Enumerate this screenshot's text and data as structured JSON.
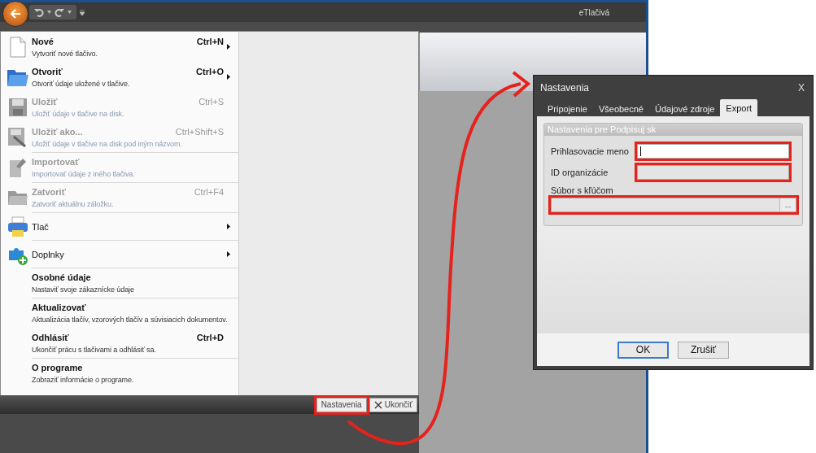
{
  "app": {
    "title": "eTlačivá"
  },
  "file_menu": {
    "items": [
      {
        "kind": "two-line",
        "title": "Nové",
        "description": "Vytvoriť nové tlačivo.",
        "shortcut": "Ctrl+N",
        "submenu": true,
        "disabled": false,
        "separator": false
      },
      {
        "kind": "two-line",
        "title": "Otvoriť",
        "description": "Otvoriť údaje uložené v tlačive.",
        "shortcut": "Ctrl+O",
        "submenu": true,
        "disabled": false,
        "separator": false
      },
      {
        "kind": "two-line",
        "title": "Uložiť",
        "description": "Uložiť údaje v tlačive na disk.",
        "shortcut": "Ctrl+S",
        "submenu": false,
        "disabled": true,
        "separator": false
      },
      {
        "kind": "two-line",
        "title": "Uložiť ako...",
        "description": "Uložiť údaje v tlačive na disk pod iným názvom.",
        "shortcut": "Ctrl+Shift+S",
        "submenu": false,
        "disabled": true,
        "separator": false
      },
      {
        "kind": "two-line",
        "title": "Importovať",
        "description": "Importovať údaje z iného tlačiva.",
        "submenu": false,
        "disabled": true,
        "separator": true
      },
      {
        "kind": "two-line",
        "title": "Zatvoriť",
        "description": "Zatvoriť aktuálnu záložku.",
        "shortcut": "Ctrl+F4",
        "submenu": false,
        "disabled": true,
        "separator": true
      },
      {
        "kind": "single",
        "title": "Tlač",
        "submenu": true,
        "disabled": false,
        "separator": true
      },
      {
        "kind": "single",
        "title": "Doplnky",
        "submenu": true,
        "disabled": false,
        "separator": true
      },
      {
        "kind": "two-line",
        "title": "Osobné údaje",
        "description": "Nastaviť svoje zákaznícke údaje",
        "submenu": false,
        "disabled": false,
        "separator": true
      },
      {
        "kind": "two-line",
        "title": "Aktualizovať",
        "description": "Aktualizácia tlačív, vzorových tlačív a súvisiacich dokumentov.",
        "submenu": false,
        "disabled": false,
        "separator": true
      },
      {
        "kind": "two-line",
        "title": "Odhlásiť",
        "description": "Ukončiť prácu s tlačivami a odhlásiť sa.",
        "shortcut": "Ctrl+D",
        "submenu": false,
        "disabled": false,
        "separator": false
      },
      {
        "kind": "two-line",
        "title": "O programe",
        "description": "Zobraziť informácie o programe.",
        "submenu": false,
        "disabled": false,
        "separator": true
      }
    ],
    "footer_buttons": [
      {
        "kind": "settings",
        "label": "Nastavenia",
        "highlighted": true
      },
      {
        "kind": "exit",
        "label": "Ukončiť",
        "highlighted": false
      }
    ]
  },
  "dialog": {
    "title": "Nastavenia",
    "close": "X",
    "tabs": [
      {
        "label": "Pripojenie",
        "selected": false
      },
      {
        "label": "Všeobecné",
        "selected": false
      },
      {
        "label": "Údajové zdroje",
        "selected": false
      },
      {
        "label": "Export",
        "selected": true
      }
    ],
    "group_title": "Nastavenia pre Podpisuj sk",
    "fields": [
      {
        "kind": "inline",
        "label": "Prihlasovacie meno",
        "disabled": false,
        "focused": true,
        "highlighted": true
      },
      {
        "kind": "inline",
        "label": "ID organizácie",
        "disabled": true,
        "focused": false,
        "highlighted": true
      },
      {
        "kind": "browse",
        "label": "Súbor s kľúčom",
        "browse": "...",
        "disabled": true,
        "focused": false,
        "highlighted": true
      }
    ],
    "buttons": [
      {
        "label": "OK",
        "default": true
      },
      {
        "label": "Zrušiť",
        "default": false
      }
    ]
  }
}
